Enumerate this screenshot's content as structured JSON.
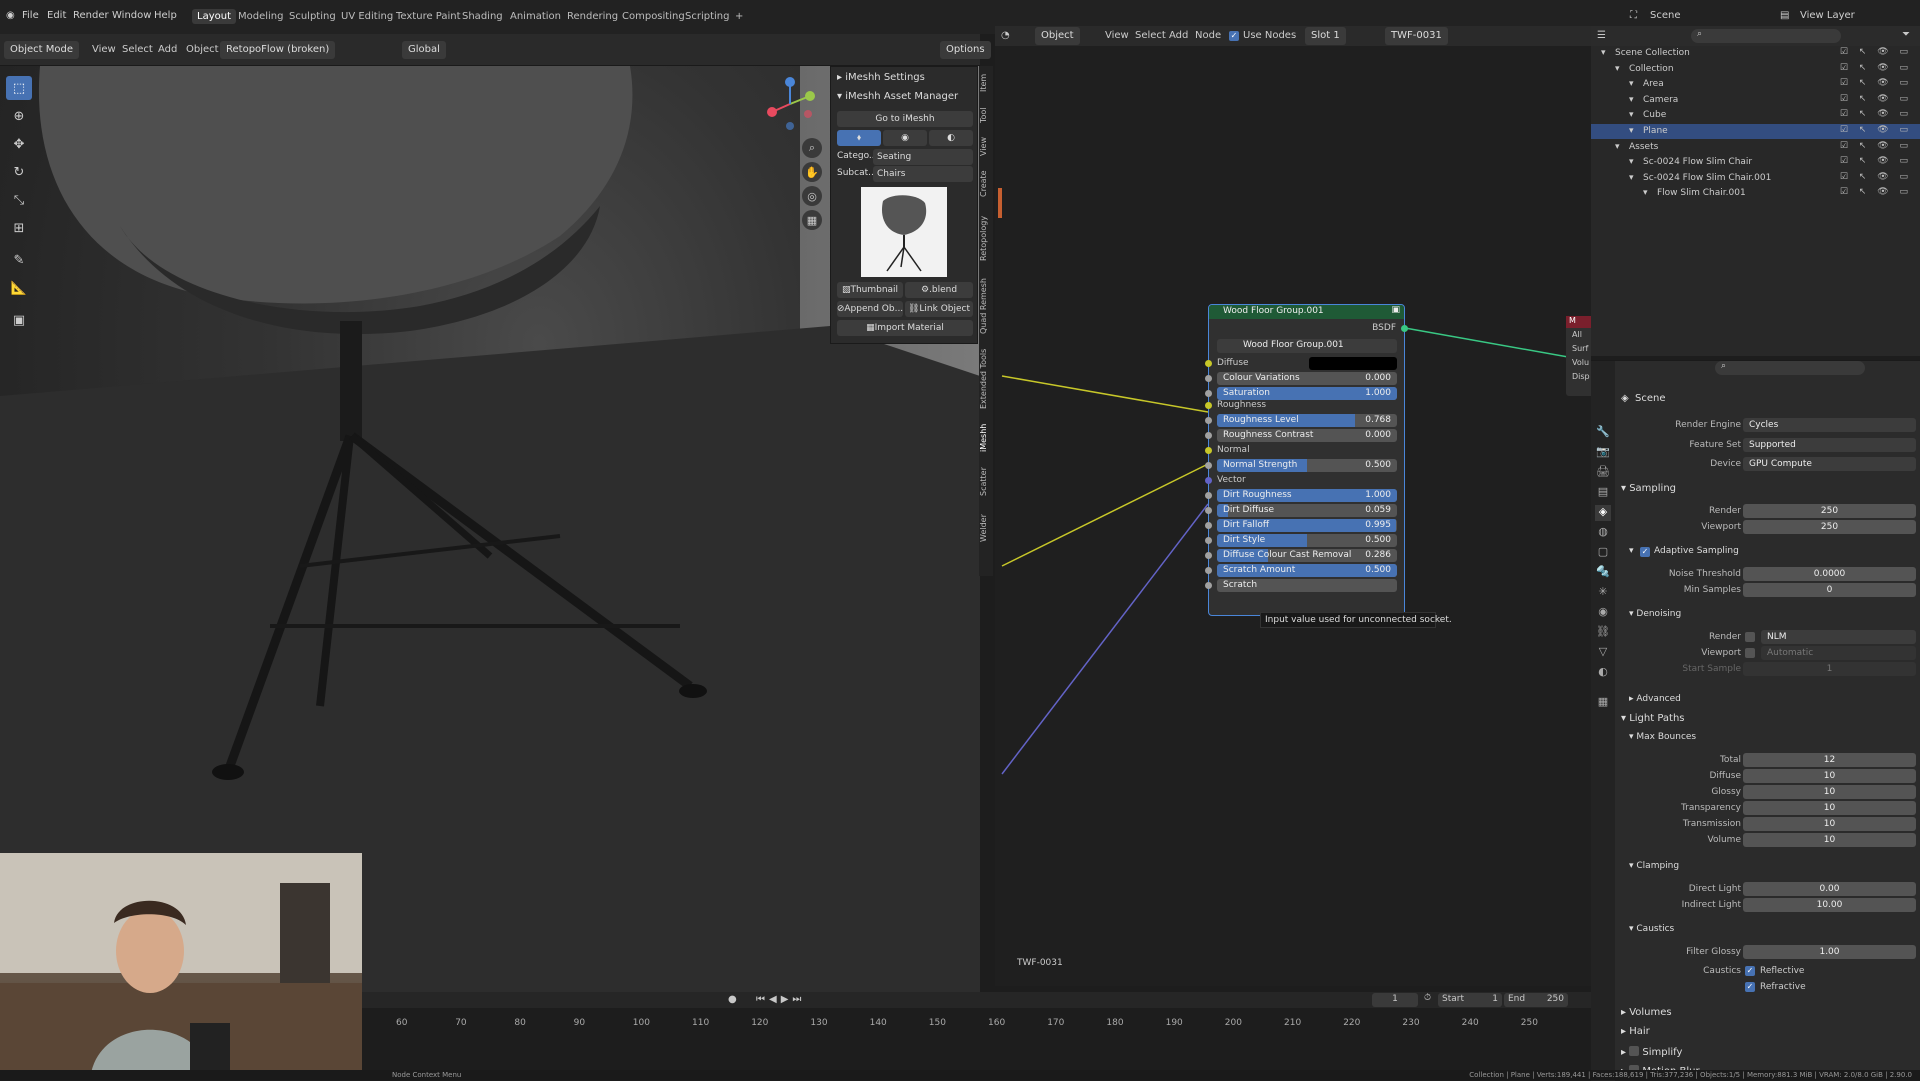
{
  "menubar": {
    "menus": [
      "File",
      "Edit",
      "Render",
      "Window",
      "Help"
    ],
    "workspaces": [
      "Layout",
      "Modeling",
      "Sculpting",
      "UV Editing",
      "Texture Paint",
      "Shading",
      "Animation",
      "Rendering",
      "Compositing",
      "Scripting"
    ],
    "active_workspace": "Layout",
    "add_workspace": "+",
    "scene": "Scene",
    "view_layer": "View Layer"
  },
  "viewport_header": {
    "mode": "Object Mode",
    "menus": [
      "View",
      "Select",
      "Add",
      "Object"
    ],
    "addon_menu": "RetopoFlow (broken)",
    "transform": "Global",
    "options": "Options"
  },
  "npanel": {
    "settings": "iMeshh Settings",
    "asset_manager": "iMeshh Asset Manager",
    "go_to": "Go to iMeshh",
    "category_label": "Catego...",
    "category_value": "Seating",
    "subcategory_label": "Subcat...",
    "subcategory_value": "Chairs",
    "thumbnail_btn": "Thumbnail",
    "blend_btn": ".blend",
    "append_btn": "Append Ob...",
    "link_btn": "Link Object",
    "import_btn": "Import Material"
  },
  "sidebar_tabs": [
    "Item",
    "Tool",
    "View",
    "Create",
    "Retopology",
    "Quad Remesh",
    "Extended Tools",
    "iMeshh",
    "Scatter",
    "Welder"
  ],
  "node_header": {
    "object": "Object",
    "menus": [
      "View",
      "Select",
      "Add",
      "Node"
    ],
    "use_nodes": "Use Nodes",
    "slot": "Slot 1",
    "material": "TWF-0031"
  },
  "node": {
    "title": "Wood Floor Group.001",
    "output": "BSDF",
    "group": "Wood Floor Group.001",
    "sections": {
      "diffuse": "Diffuse",
      "roughness": "Roughness",
      "normal": "Normal",
      "vector": "Vector"
    },
    "rows": [
      {
        "label": "Colour Variations",
        "value": "0.000",
        "fill": 0.0
      },
      {
        "label": "Saturation",
        "value": "1.000",
        "fill": 1.0
      },
      {
        "label": "Roughness Level",
        "value": "0.768",
        "fill": 0.768
      },
      {
        "label": "Roughness Contrast",
        "value": "0.000",
        "fill": 0.0
      },
      {
        "label": "Normal Strength",
        "value": "0.500",
        "fill": 0.5
      },
      {
        "label": "Dirt Roughness",
        "value": "1.000",
        "fill": 1.0
      },
      {
        "label": "Dirt Diffuse",
        "value": "0.059",
        "fill": 0.059
      },
      {
        "label": "Dirt Falloff",
        "value": "0.995",
        "fill": 0.995
      },
      {
        "label": "Dirt Style",
        "value": "0.500",
        "fill": 0.5
      },
      {
        "label": "Diffuse Colour Cast Removal",
        "value": "0.286",
        "fill": 0.286
      },
      {
        "label": "Scratch Amount",
        "value": "0.500",
        "fill": 1.0
      },
      {
        "label": "Scratch",
        "value": "",
        "fill": 0.0
      }
    ],
    "material_label": "TWF-0031",
    "partial_node": "M",
    "partial_node_all": "All",
    "partial_sockets": [
      "Surf",
      "Volu",
      "Disp"
    ]
  },
  "tooltip": "Input value used for unconnected socket.",
  "outliner": {
    "rows": [
      {
        "name": "Scene Collection",
        "indent": 0,
        "selected": false
      },
      {
        "name": "Collection",
        "indent": 1,
        "selected": false
      },
      {
        "name": "Area",
        "indent": 2,
        "selected": false
      },
      {
        "name": "Camera",
        "indent": 2,
        "selected": false
      },
      {
        "name": "Cube",
        "indent": 2,
        "selected": false
      },
      {
        "name": "Plane",
        "indent": 2,
        "selected": true
      },
      {
        "name": "Assets",
        "indent": 1,
        "selected": false
      },
      {
        "name": "Sc-0024 Flow Slim Chair",
        "indent": 2,
        "selected": false
      },
      {
        "name": "Sc-0024 Flow Slim Chair.001",
        "indent": 2,
        "selected": false
      },
      {
        "name": "Flow Slim Chair.001",
        "indent": 3,
        "selected": false
      }
    ]
  },
  "properties": {
    "context": "Scene",
    "render_engine_label": "Render Engine",
    "render_engine": "Cycles",
    "feature_set_label": "Feature Set",
    "feature_set": "Supported",
    "device_label": "Device",
    "device": "GPU Compute",
    "sampling": "Sampling",
    "render_label": "Render",
    "render_samples": "250",
    "viewport_label": "Viewport",
    "viewport_samples": "250",
    "adaptive": "Adaptive Sampling",
    "noise_label": "Noise Threshold",
    "noise": "0.0000",
    "min_samples_label": "Min Samples",
    "min_samples": "0",
    "denoising": "Denoising",
    "den_render_label": "Render",
    "den_render": "NLM",
    "den_viewport_label": "Viewport",
    "den_viewport": "Automatic",
    "start_sample_label": "Start Sample",
    "start_sample": "1",
    "advanced": "Advanced",
    "light_paths": "Light Paths",
    "max_bounces": "Max Bounces",
    "bounces": [
      {
        "label": "Total",
        "value": "12"
      },
      {
        "label": "Diffuse",
        "value": "10"
      },
      {
        "label": "Glossy",
        "value": "10"
      },
      {
        "label": "Transparency",
        "value": "10"
      },
      {
        "label": "Transmission",
        "value": "10"
      },
      {
        "label": "Volume",
        "value": "10"
      }
    ],
    "clamping": "Clamping",
    "direct_label": "Direct Light",
    "direct": "0.00",
    "indirect_label": "Indirect Light",
    "indirect": "10.00",
    "caustics": "Caustics",
    "filter_glossy_label": "Filter Glossy",
    "filter_glossy": "1.00",
    "caustics_label": "Caustics",
    "reflective": "Reflective",
    "refractive": "Refractive",
    "volumes": "Volumes",
    "hair": "Hair",
    "simplify": "Simplify",
    "motion_blur": "Motion Blur"
  },
  "timeline": {
    "current": "1",
    "start_label": "Start",
    "start": "1",
    "end_label": "End",
    "end": "250",
    "ticks": [
      "60",
      "70",
      "80",
      "90",
      "100",
      "110",
      "120",
      "130",
      "140",
      "150",
      "160",
      "170",
      "180",
      "190",
      "200",
      "210",
      "220",
      "230",
      "240",
      "250"
    ]
  },
  "statusbar": {
    "left": "Node Context Menu",
    "right": "Collection | Plane | Verts:189,441 | Faces:188,619 | Tris:377,236 | Objects:1/5 | Memory:881.3 MiB | VRAM: 2.0/8.0 GiB | 2.90.0"
  }
}
